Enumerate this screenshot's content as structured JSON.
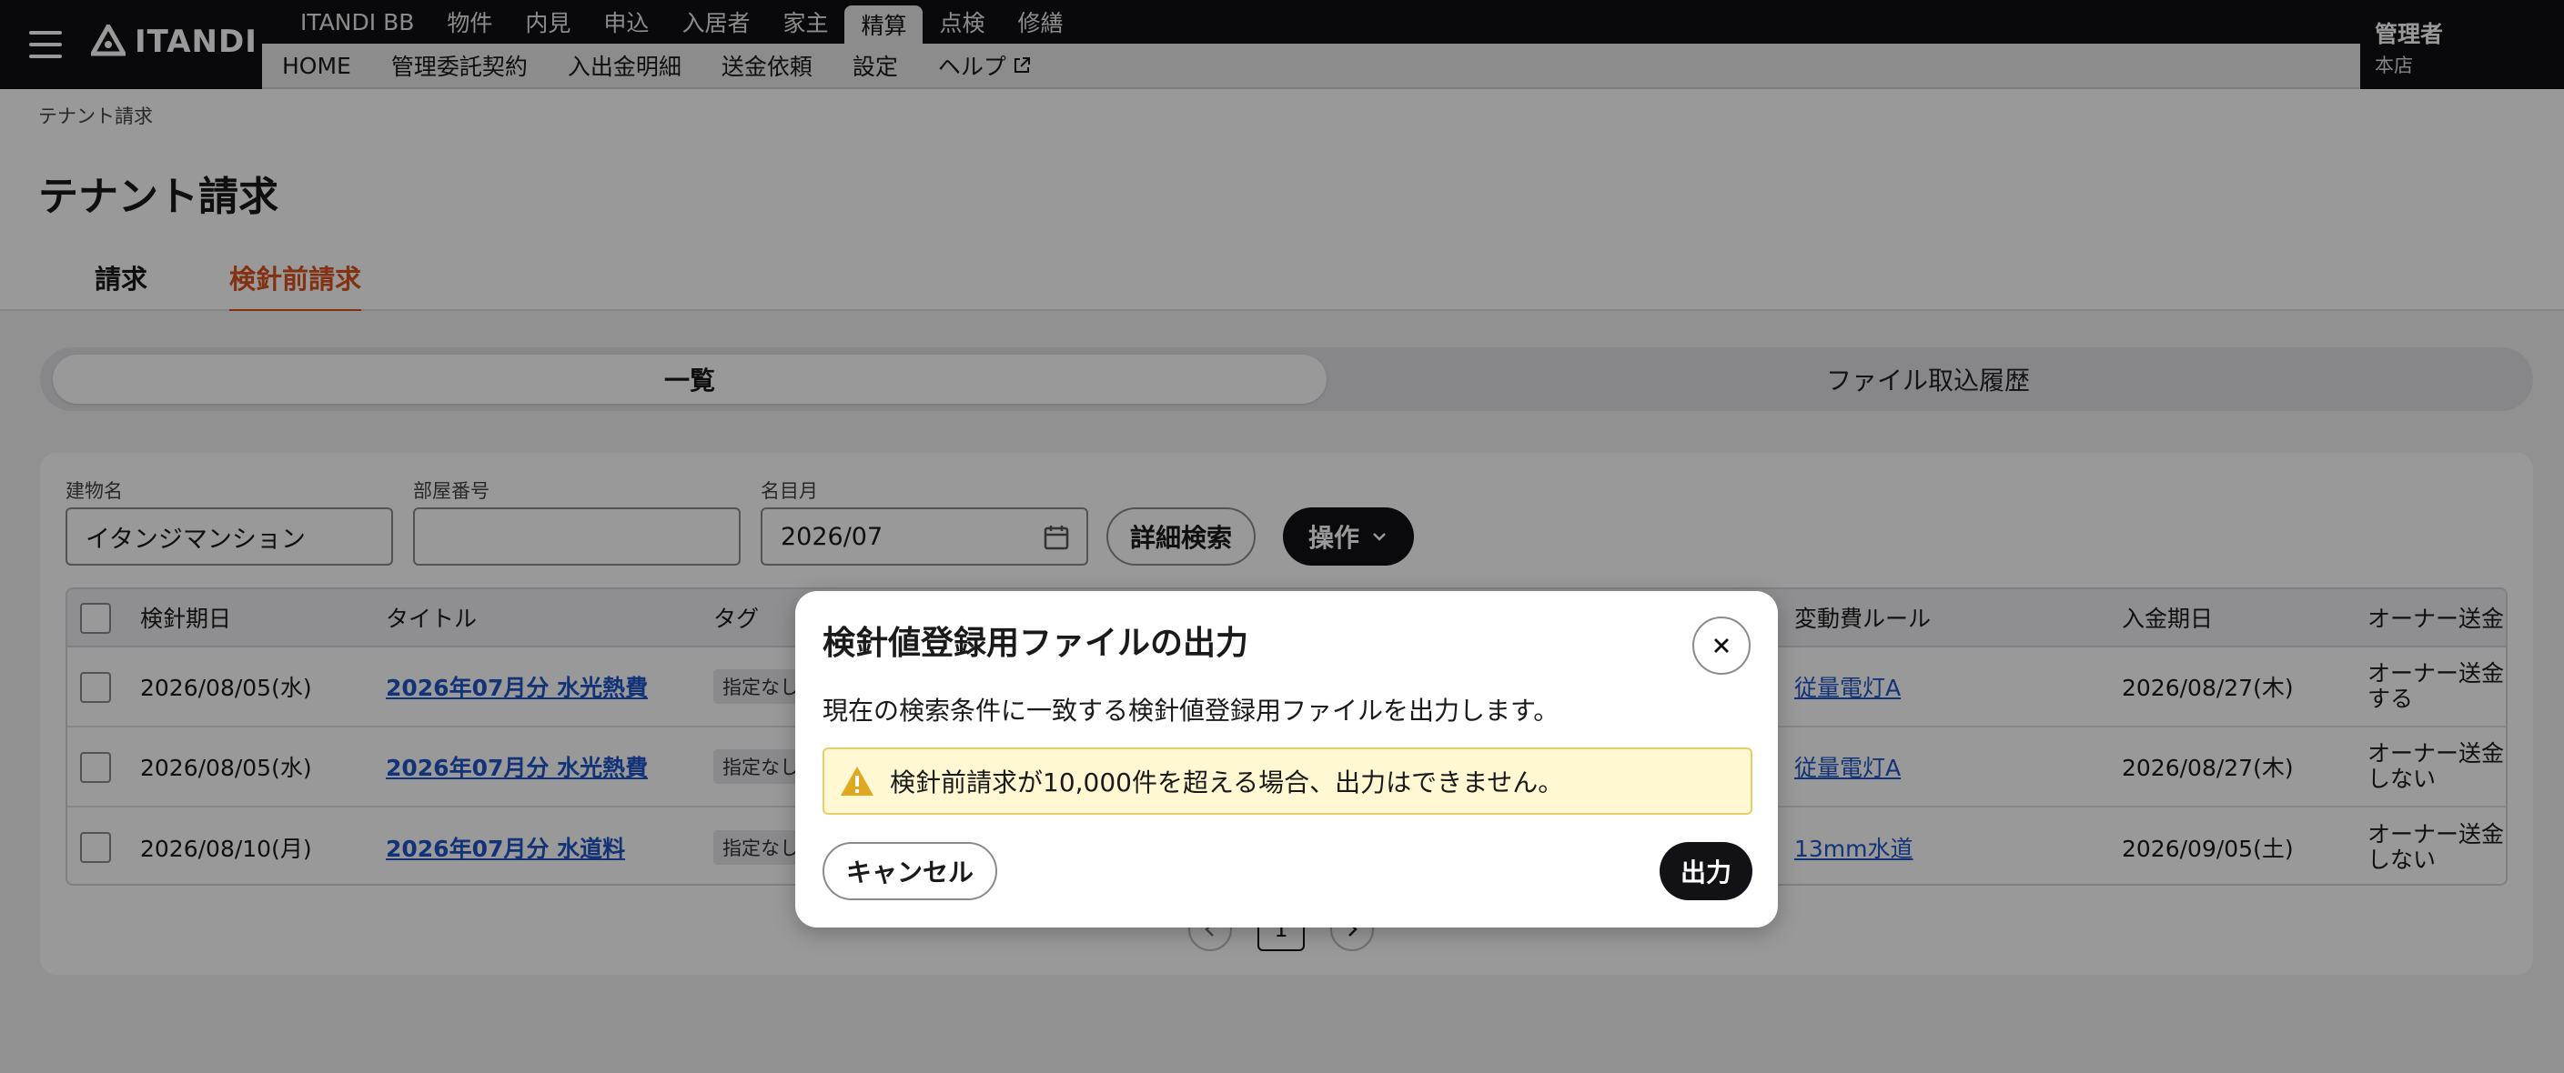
{
  "app": {
    "logo_text": "ITANDI"
  },
  "nav": {
    "primary": [
      "ITANDI BB",
      "物件",
      "内見",
      "申込",
      "入居者",
      "家主",
      "精算",
      "点検",
      "修繕"
    ],
    "primary_active_index": 6,
    "secondary": [
      "HOME",
      "管理委託契約",
      "入出金明細",
      "送金依頼",
      "設定",
      "ヘルプ"
    ]
  },
  "user": {
    "name": "管理者",
    "branch": "本店"
  },
  "breadcrumb": "テナント請求",
  "page_title": "テナント請求",
  "tabs": [
    {
      "label": "請求",
      "active": false
    },
    {
      "label": "検針前請求",
      "active": true
    }
  ],
  "segments": [
    {
      "label": "一覧",
      "active": true
    },
    {
      "label": "ファイル取込履歴",
      "active": false
    }
  ],
  "filters": {
    "building": {
      "label": "建物名",
      "value": "イタンジマンション"
    },
    "room": {
      "label": "部屋番号",
      "value": ""
    },
    "month": {
      "label": "名目月",
      "value": "2026/07"
    },
    "detail_search": "詳細検索",
    "operations": "操作"
  },
  "table": {
    "headers": {
      "reading_date": "検針期日",
      "title": "タイトル",
      "tag": "タグ",
      "rule": "変動費ルール",
      "payment_date": "入金期日",
      "owner": "オーナー送金"
    },
    "rows": [
      {
        "reading_date": "2026/08/05(水)",
        "title": "2026年07月分 水光熱費",
        "tag": "指定なし",
        "rule": "従量電灯A",
        "payment_date": "2026/08/27(木)",
        "owner_1": "オーナー送金",
        "owner_2": "する"
      },
      {
        "reading_date": "2026/08/05(水)",
        "title": "2026年07月分 水光熱費",
        "tag": "指定なし",
        "rule": "従量電灯A",
        "payment_date": "2026/08/27(木)",
        "owner_1": "オーナー送金",
        "owner_2": "しない"
      },
      {
        "reading_date": "2026/08/10(月)",
        "title": "2026年07月分 水道料",
        "tag": "指定なし",
        "rule": "13mm水道",
        "payment_date": "2026/09/05(土)",
        "owner_1": "オーナー送金",
        "owner_2": "しない"
      }
    ]
  },
  "pagination": {
    "current": "1"
  },
  "modal": {
    "title": "検針値登録用ファイルの出力",
    "description": "現在の検索条件に一致する検針値登録用ファイルを出力します。",
    "warning": "検針前請求が10,000件を超える場合、出力はできません。",
    "cancel": "キャンセル",
    "submit": "出力"
  },
  "colors": {
    "accent": "#d9531e",
    "link": "#1f55c8",
    "dark": "#111116",
    "warning_bg": "#fff8d3"
  }
}
